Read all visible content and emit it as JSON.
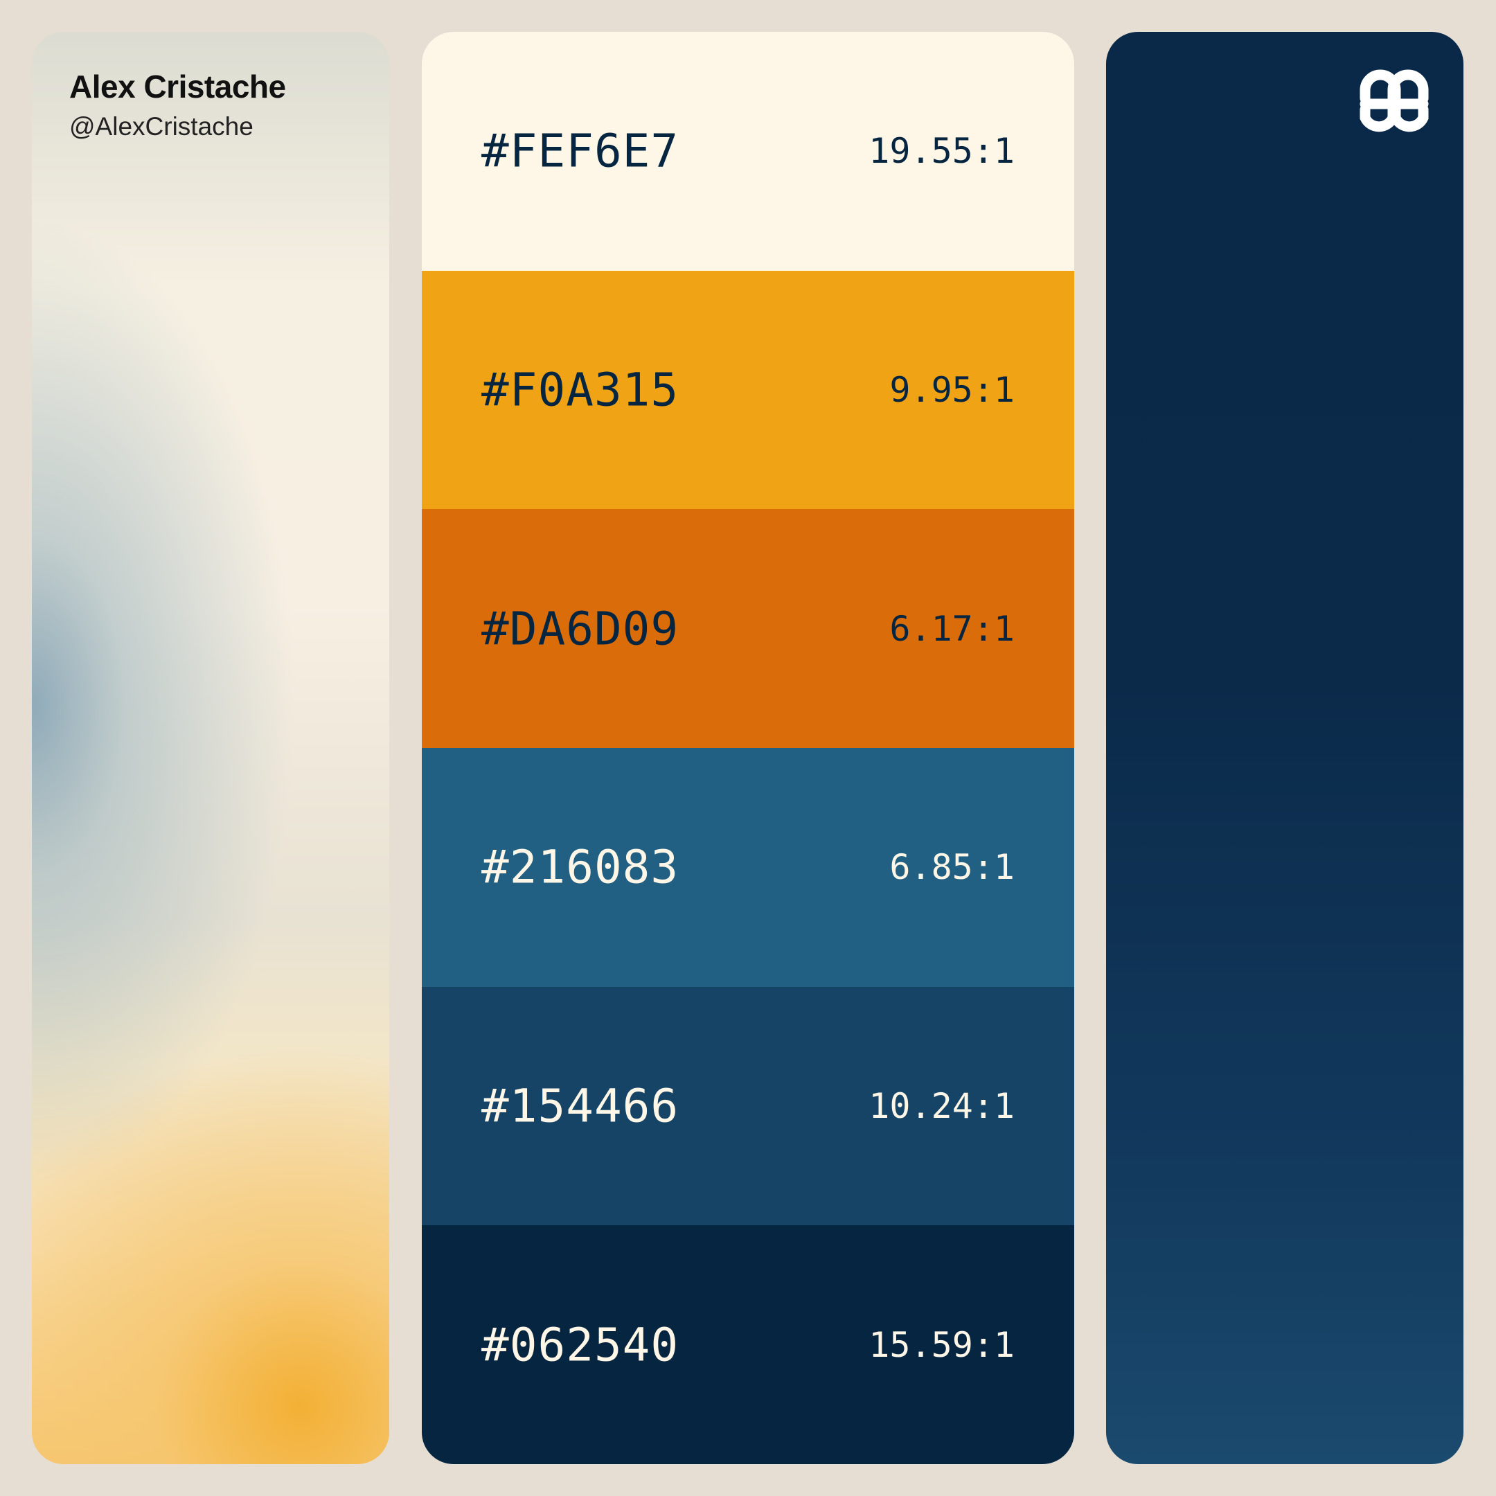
{
  "author": {
    "name": "Alex Cristache",
    "handle": "@AlexCristache"
  },
  "palette": [
    {
      "hex": "#FEF6E7",
      "ratio": "19.55:1",
      "bg": "#FEF6E7",
      "text_color": "#062540"
    },
    {
      "hex": "#F0A315",
      "ratio": "9.95:1",
      "bg": "#F0A315",
      "text_color": "#062540"
    },
    {
      "hex": "#DA6D09",
      "ratio": "6.17:1",
      "bg": "#DA6D09",
      "text_color": "#062540"
    },
    {
      "hex": "#216083",
      "ratio": "6.85:1",
      "bg": "#216083",
      "text_color": "#FEF6E7"
    },
    {
      "hex": "#154466",
      "ratio": "10.24:1",
      "bg": "#154466",
      "text_color": "#FEF6E7"
    },
    {
      "hex": "#062540",
      "ratio": "15.59:1",
      "bg": "#062540",
      "text_color": "#FEF6E7"
    }
  ],
  "logo_icon": "brand-logo-icon",
  "background_color": "#E6DDD3"
}
